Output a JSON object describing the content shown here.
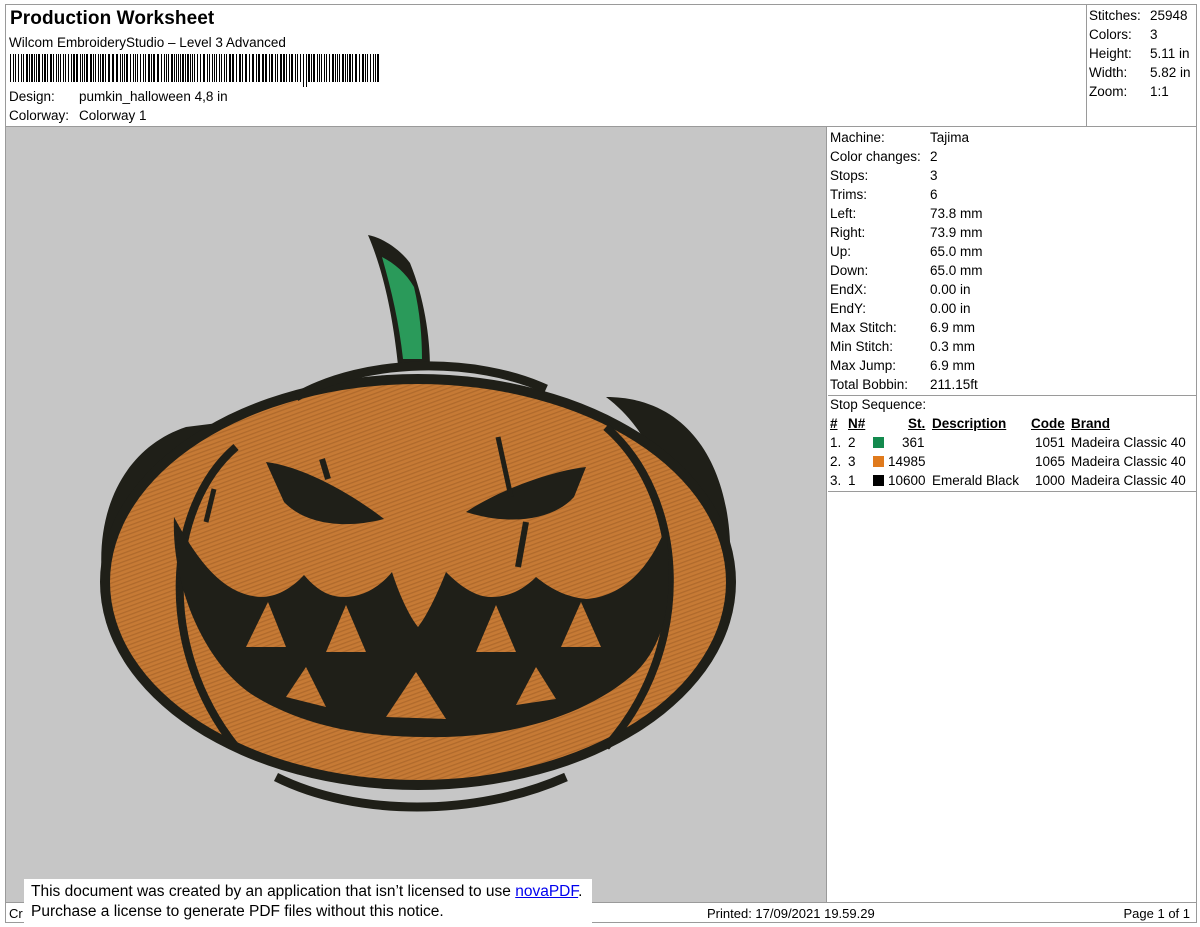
{
  "header": {
    "title": "Production Worksheet",
    "software": "Wilcom EmbroideryStudio – Level 3 Advanced",
    "design_label": "Design:",
    "design_value": "pumkin_halloween 4,8 in",
    "colorway_label": "Colorway:",
    "colorway_value": "Colorway 1"
  },
  "stats": [
    {
      "label": "Stitches:",
      "value": "25948"
    },
    {
      "label": "Colors:",
      "value": "3"
    },
    {
      "label": "Height:",
      "value": "5.11 in"
    },
    {
      "label": "Width:",
      "value": "5.82 in"
    },
    {
      "label": "Zoom:",
      "value": "1:1"
    }
  ],
  "machine_info": [
    {
      "label": "Machine:",
      "value": "Tajima"
    },
    {
      "label": "Color changes:",
      "value": "2"
    },
    {
      "label": "Stops:",
      "value": "3"
    },
    {
      "label": "Trims:",
      "value": "6"
    },
    {
      "label": "Left:",
      "value": "73.8 mm"
    },
    {
      "label": "Right:",
      "value": "73.9 mm"
    },
    {
      "label": "Up:",
      "value": "65.0 mm"
    },
    {
      "label": "Down:",
      "value": "65.0 mm"
    },
    {
      "label": "EndX:",
      "value": "0.00 in"
    },
    {
      "label": "EndY:",
      "value": "0.00 in"
    },
    {
      "label": "Max Stitch:",
      "value": "6.9 mm"
    },
    {
      "label": "Min Stitch:",
      "value": "0.3 mm"
    },
    {
      "label": "Max Jump:",
      "value": "6.9 mm"
    },
    {
      "label": "Total Bobbin:",
      "value": "211.15ft"
    }
  ],
  "stop_sequence": {
    "title": "Stop Sequence:",
    "headers": {
      "num": "#",
      "needle": "N#",
      "stitches": "St.",
      "description": "Description",
      "code": "Code",
      "brand": "Brand"
    },
    "rows": [
      {
        "num": "1.",
        "needle": "2",
        "color": "#138a4e",
        "stitches": "361",
        "description": "",
        "code": "1051",
        "brand": "Madeira Classic 40"
      },
      {
        "num": "2.",
        "needle": "3",
        "color": "#e07a1c",
        "stitches": "14985",
        "description": "",
        "code": "1065",
        "brand": "Madeira Classic 40"
      },
      {
        "num": "3.",
        "needle": "1",
        "color": "#000000",
        "stitches": "10600",
        "description": "Emerald Black",
        "code": "1000",
        "brand": "Madeira Classic 40"
      }
    ]
  },
  "footer": {
    "created_prefix": "Cr",
    "printed": "Printed: 17/09/2021 19.59.29",
    "page": "Page 1 of 1"
  },
  "notice": {
    "line1_prefix": "This document was created by an application that isn’t licensed to use ",
    "link_text": "novaPDF",
    "line1_suffix": ".",
    "line2": "Purchase a license to generate PDF files without this notice."
  },
  "colors": {
    "background_preview": "#c6c6c6",
    "pumpkin_orange": "#c67a35",
    "outline_black": "#1f1f18",
    "stem_green": "#2a9a5a",
    "link": "#0000ee"
  }
}
